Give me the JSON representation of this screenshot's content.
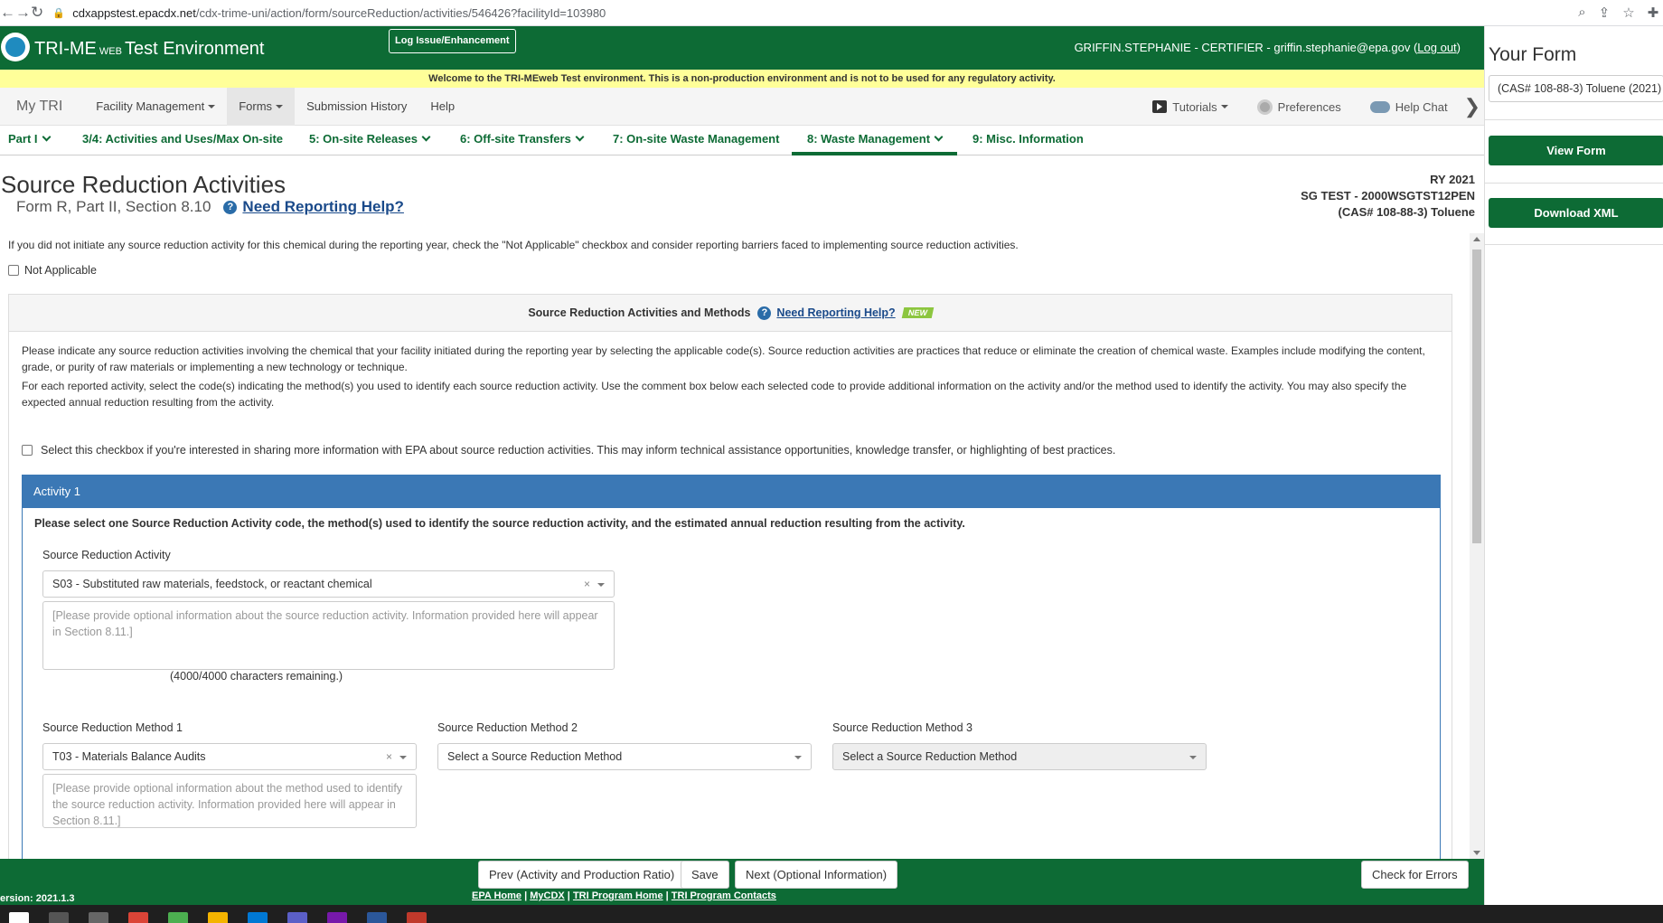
{
  "browser": {
    "url_host": "cdxappstest.epacdx.net",
    "url_path": "/cdx-trime-uni/action/form/sourceReduction/activities/546426?facilityId=103980"
  },
  "header": {
    "app_name": "TRI-ME",
    "app_web": "WEB",
    "app_env": "Test Environment",
    "log_issue": "Log Issue/Enhancement",
    "user": "GRIFFIN.STEPHANIE - CERTIFIER - griffin.stephanie@epa.gov (",
    "logout": "Log out",
    "user_close": ")",
    "notice": "Welcome to the TRI-MEweb Test environment. This is a non-production environment and is not to be used for any regulatory activity."
  },
  "nav": {
    "brand": "My TRI",
    "items": [
      "Facility Management",
      "Forms",
      "Submission History",
      "Help"
    ],
    "tutorials": "Tutorials",
    "preferences": "Preferences",
    "help_chat": "Help Chat"
  },
  "tabs": [
    "Part I",
    "3/4: Activities and Uses/Max On-site",
    "5: On-site Releases",
    "6: Off-site Transfers",
    "7: On-site Waste Management",
    "8: Waste Management",
    "9: Misc. Information"
  ],
  "page": {
    "title": "Source Reduction Activities",
    "subtitle": "Form R, Part II, Section 8.10",
    "help": "Need Reporting Help?",
    "ry": "RY 2021",
    "facility": "SG TEST - 2000WSGTST12PEN",
    "chemical": "(CAS# 108-88-3) Toluene"
  },
  "content": {
    "intro": "If you did not initiate any source reduction activity for this chemical during the reporting year, check the \"Not Applicable\" checkbox and consider reporting barriers faced to implementing source reduction activities.",
    "not_applicable": "Not Applicable",
    "panel_title": "Source Reduction Activities and Methods",
    "panel_help": "Need Reporting Help?",
    "new_badge": "NEW",
    "para1": "Please indicate any source reduction activities involving the chemical that your facility initiated during the reporting year by selecting the applicable code(s). Source reduction activities are practices that reduce or eliminate the creation of chemical waste. Examples include modifying the content, grade, or purity of raw materials or implementing a new technology or technique.",
    "para2": "For each reported activity, select the code(s) indicating the method(s) you used to identify each source reduction activity. Use the comment box below each selected code to provide additional information on the activity and/or the method used to identify the activity. You may also specify the expected annual reduction resulting from the activity.",
    "share": "Select this checkbox if you're interested in sharing more information with EPA about source reduction activities. This may inform technical assistance opportunities, knowledge transfer, or highlighting of best practices.",
    "activity_head": "Activity  1",
    "activity_note": "Please select one Source Reduction Activity code, the method(s) used to identify the source reduction activity, and the estimated annual reduction resulting from the activity.",
    "activity_label": "Source Reduction Activity",
    "activity_value": "S03 - Substituted raw materials, feedstock, or reactant chemical",
    "activity_placeholder": "[Please provide optional information about the source reduction activity. Information provided here will appear in Section 8.11.]",
    "chars": "(4000/4000 characters remaining.)",
    "method1_label": "Source Reduction Method 1",
    "method1_value": "T03 - Materials Balance Audits",
    "method1_placeholder": "[Please provide optional information about the method used to identify the source reduction activity. Information provided here will appear in Section 8.11.]",
    "method2_label": "Source Reduction Method 2",
    "method2_value": "Select a Source Reduction Method",
    "method3_label": "Source Reduction Method 3",
    "method3_value": "Select a Source Reduction Method",
    "clear": "×"
  },
  "footer": {
    "prev": "Prev (Activity and Production Ratio)",
    "save": "Save",
    "next": "Next (Optional Information)",
    "check": "Check for Errors",
    "version": "ersion: 2021.1.3",
    "links": [
      "EPA Home",
      "MyCDX",
      "TRI Program Home",
      "TRI Program Contacts"
    ]
  },
  "sidebar": {
    "title": "Your Form",
    "chemical": "(CAS# 108-88-3) Toluene (2021)",
    "view": "View Form",
    "download": "Download XML"
  }
}
